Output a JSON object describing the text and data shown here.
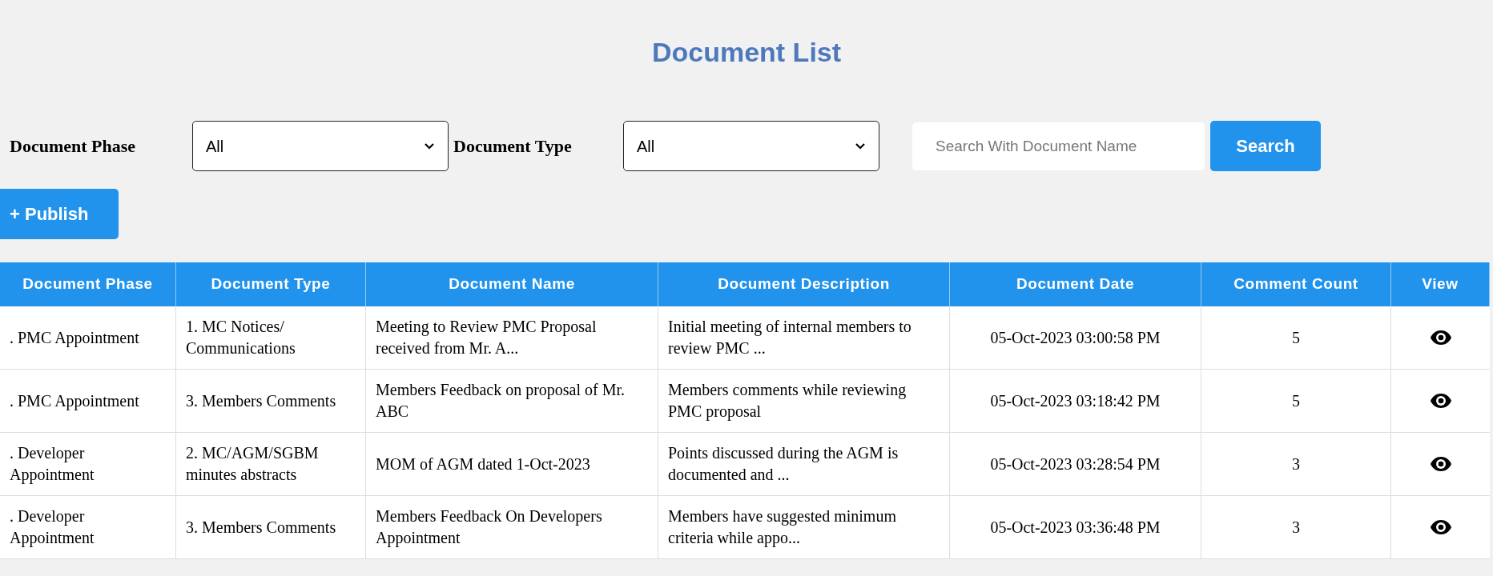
{
  "title": "Document List",
  "filters": [
    {
      "label": "Document Phase",
      "value": "All"
    },
    {
      "label": "Document Type",
      "value": "All"
    }
  ],
  "search": {
    "placeholder": "Search With Document Name",
    "button": "Search"
  },
  "publish_button": "+ Publish",
  "table": {
    "columns": [
      "Document Phase",
      "Document Type",
      "Document Name",
      "Document Description",
      "Document Date",
      "Comment Count",
      "View"
    ],
    "rows": [
      {
        "phase": ". PMC Appointment",
        "type": "1. MC Notices/ Communications",
        "name": "Meeting to Review PMC Proposal received from Mr. A...",
        "description": "Initial meeting of internal members to review PMC ...",
        "date": "05-Oct-2023 03:00:58 PM",
        "count": "5"
      },
      {
        "phase": ". PMC Appointment",
        "type": "3. Members Comments",
        "name": "Members Feedback on proposal of Mr. ABC",
        "description": "Members comments while reviewing PMC proposal",
        "date": "05-Oct-2023 03:18:42 PM",
        "count": "5"
      },
      {
        "phase": ". Developer Appointment",
        "type": "2. MC/AGM/SGBM minutes abstracts",
        "name": "MOM of AGM dated 1-Oct-2023",
        "description": "Points discussed during the AGM is documented and ...",
        "date": "05-Oct-2023 03:28:54 PM",
        "count": "3"
      },
      {
        "phase": ". Developer Appointment",
        "type": "3. Members Comments",
        "name": "Members Feedback On Developers Appointment",
        "description": "Members have suggested minimum criteria while appo...",
        "date": "05-Oct-2023 03:36:48 PM",
        "count": "3"
      }
    ]
  }
}
